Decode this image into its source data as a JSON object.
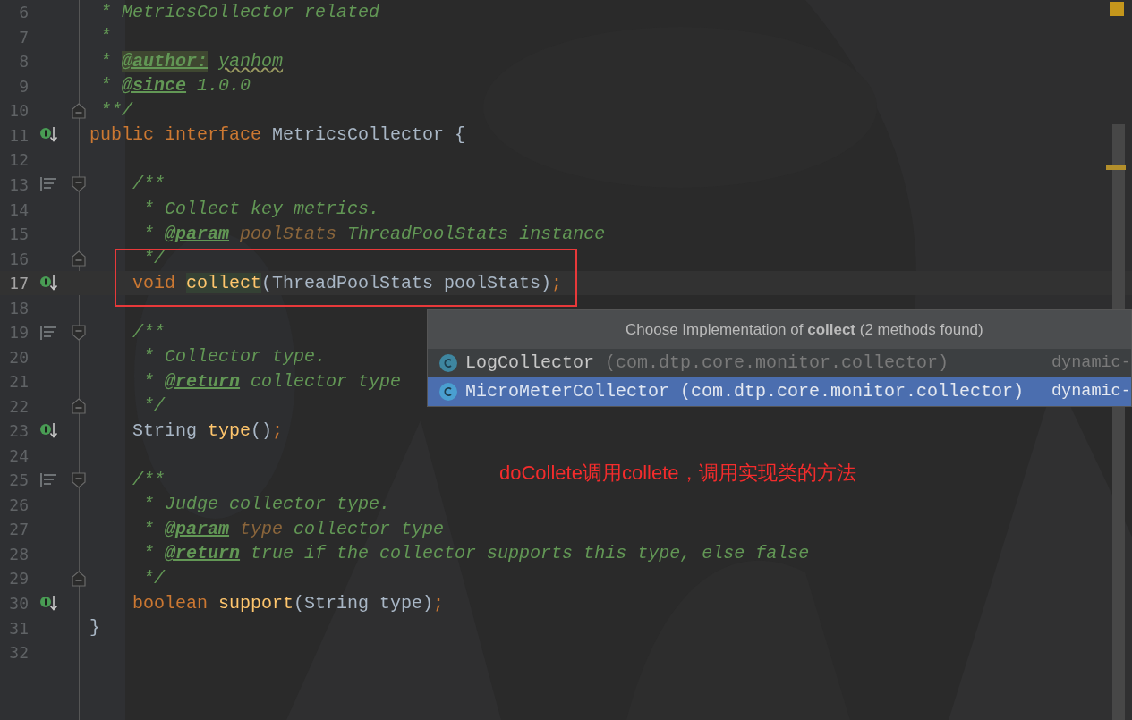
{
  "editor": {
    "lines": [
      {
        "number": "6",
        "current": false,
        "tokens": [
          {
            "text": " * MetricsCollector related",
            "kind": "comment"
          }
        ]
      },
      {
        "number": "7",
        "current": false,
        "tokens": [
          {
            "text": " *",
            "kind": "comment"
          }
        ]
      },
      {
        "number": "8",
        "current": false,
        "tokens": [
          {
            "text": " * ",
            "kind": "comment"
          },
          {
            "text": "@author:",
            "kind": "tag_hl"
          },
          {
            "text": " yanhom",
            "kind": "typo"
          }
        ]
      },
      {
        "number": "9",
        "current": false,
        "tokens": [
          {
            "text": " * ",
            "kind": "comment"
          },
          {
            "text": "@since",
            "kind": "tag"
          },
          {
            "text": " 1.0.0",
            "kind": "comment"
          }
        ]
      },
      {
        "number": "10",
        "current": false,
        "fold": {
          "kind": "end"
        },
        "tokens": [
          {
            "text": " **/",
            "kind": "comment"
          }
        ]
      },
      {
        "number": "11",
        "current": false,
        "marker": {
          "kind": "implemented"
        },
        "tokens": [
          {
            "text": "public interface ",
            "kind": "keyword"
          },
          {
            "text": "MetricsCollector {",
            "kind": "plain"
          }
        ]
      },
      {
        "number": "12",
        "current": false
      },
      {
        "number": "13",
        "current": false,
        "marker": {
          "kind": "doc"
        },
        "fold": {
          "kind": "start"
        },
        "tokens": [
          {
            "text": "    /**",
            "kind": "comment"
          }
        ]
      },
      {
        "number": "14",
        "current": false,
        "tokens": [
          {
            "text": "     * Collect key metrics.",
            "kind": "comment"
          }
        ]
      },
      {
        "number": "15",
        "current": false,
        "tokens": [
          {
            "text": "     * ",
            "kind": "comment"
          },
          {
            "text": "@param",
            "kind": "tag"
          },
          {
            "text": " poolStats",
            "kind": "param"
          },
          {
            "text": " ThreadPoolStats instance",
            "kind": "comment"
          }
        ]
      },
      {
        "number": "16",
        "current": false,
        "fold": {
          "kind": "end"
        },
        "tokens": [
          {
            "text": "     */",
            "kind": "comment"
          }
        ]
      },
      {
        "number": "17",
        "current": true,
        "marker": {
          "kind": "implemented"
        },
        "tokens": [
          {
            "text": "    void ",
            "kind": "keyword"
          },
          {
            "text": "collect",
            "kind": "decl_hl"
          },
          {
            "text": "(ThreadPoolStats poolStats)",
            "kind": "plain"
          },
          {
            "text": ";",
            "kind": "punct"
          }
        ]
      },
      {
        "number": "18",
        "current": false
      },
      {
        "number": "19",
        "current": false,
        "marker": {
          "kind": "doc"
        },
        "fold": {
          "kind": "start"
        },
        "tokens": [
          {
            "text": "    /**",
            "kind": "comment"
          }
        ]
      },
      {
        "number": "20",
        "current": false,
        "tokens": [
          {
            "text": "     * Collector type.",
            "kind": "comment"
          }
        ]
      },
      {
        "number": "21",
        "current": false,
        "tokens": [
          {
            "text": "     * ",
            "kind": "comment"
          },
          {
            "text": "@return",
            "kind": "tag"
          },
          {
            "text": " collector type",
            "kind": "comment"
          }
        ]
      },
      {
        "number": "22",
        "current": false,
        "fold": {
          "kind": "end"
        },
        "tokens": [
          {
            "text": "     */",
            "kind": "comment"
          }
        ]
      },
      {
        "number": "23",
        "current": false,
        "marker": {
          "kind": "implemented"
        },
        "tokens": [
          {
            "text": "    String ",
            "kind": "plain"
          },
          {
            "text": "type",
            "kind": "decl"
          },
          {
            "text": "()",
            "kind": "plain"
          },
          {
            "text": ";",
            "kind": "punct"
          }
        ]
      },
      {
        "number": "24",
        "current": false
      },
      {
        "number": "25",
        "current": false,
        "marker": {
          "kind": "doc"
        },
        "fold": {
          "kind": "start"
        },
        "tokens": [
          {
            "text": "    /**",
            "kind": "comment"
          }
        ]
      },
      {
        "number": "26",
        "current": false,
        "tokens": [
          {
            "text": "     * Judge collector type.",
            "kind": "comment"
          }
        ]
      },
      {
        "number": "27",
        "current": false,
        "tokens": [
          {
            "text": "     * ",
            "kind": "comment"
          },
          {
            "text": "@param",
            "kind": "tag"
          },
          {
            "text": " type",
            "kind": "param"
          },
          {
            "text": " collector type",
            "kind": "comment"
          }
        ]
      },
      {
        "number": "28",
        "current": false,
        "tokens": [
          {
            "text": "     * ",
            "kind": "comment"
          },
          {
            "text": "@return",
            "kind": "tag"
          },
          {
            "text": " true if the collector supports this type, else false",
            "kind": "comment"
          }
        ]
      },
      {
        "number": "29",
        "current": false,
        "fold": {
          "kind": "end"
        },
        "tokens": [
          {
            "text": "     */",
            "kind": "comment"
          }
        ]
      },
      {
        "number": "30",
        "current": false,
        "marker": {
          "kind": "implemented"
        },
        "tokens": [
          {
            "text": "    boolean ",
            "kind": "keyword"
          },
          {
            "text": "support",
            "kind": "decl"
          },
          {
            "text": "(String type)",
            "kind": "plain"
          },
          {
            "text": ";",
            "kind": "punct"
          }
        ]
      },
      {
        "number": "31",
        "current": false,
        "tokens": [
          {
            "text": "}",
            "kind": "plain"
          }
        ]
      },
      {
        "number": "32",
        "current": false
      }
    ]
  },
  "popup": {
    "title": "Choose Implementation of **collect** (2 methods found)",
    "items": [
      {
        "name": "LogCollector",
        "package": "(com.dtp.core.monitor.collector)",
        "module": "dynamic-",
        "selected": false
      },
      {
        "name": "MicroMeterCollector",
        "package": "(com.dtp.core.monitor.collector)",
        "module": "dynamic-",
        "selected": true
      }
    ]
  },
  "annotation": {
    "text": "doCollete调用collete，调用实现类的方法"
  }
}
